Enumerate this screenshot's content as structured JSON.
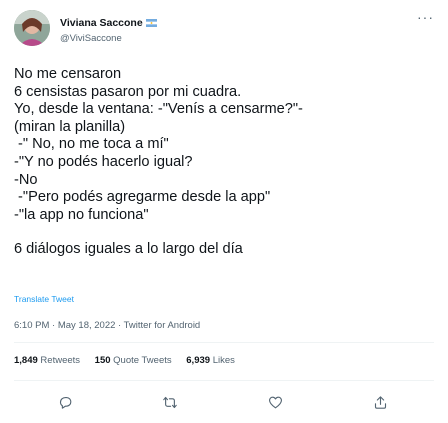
{
  "user": {
    "display_name": "Viviana Saccone",
    "handle": "@ViviSaccone",
    "flag_icon": "argentina-flag-icon"
  },
  "tweet": {
    "lines": [
      "No me censaron",
      "6 censistas pasaron por mi cuadra.",
      "Yo, desde la ventana: -\"Venís a censarme?\"-",
      "(miran la planilla)",
      " -\" No, no me toca a mí\"",
      "-\"Y no podés hacerlo igual?",
      "-No",
      " -\"Pero podés agregarme desde la app\"",
      "-\"la app no funciona\""
    ],
    "closing": "6 diálogos iguales a lo largo del día"
  },
  "translate_label": "Translate Tweet",
  "meta": "6:10 PM · May 18, 2022 · Twitter for Android",
  "stats": {
    "retweets_count": "1,849",
    "retweets_label": "Retweets",
    "quotes_count": "150",
    "quotes_label": "Quote Tweets",
    "likes_count": "6,939",
    "likes_label": "Likes"
  },
  "actions": [
    "reply-icon",
    "retweet-icon",
    "like-icon",
    "share-icon"
  ],
  "colors": {
    "text": "#0f1419",
    "muted": "#536471",
    "link": "#1d9bf0",
    "divider": "#eff3f4"
  }
}
